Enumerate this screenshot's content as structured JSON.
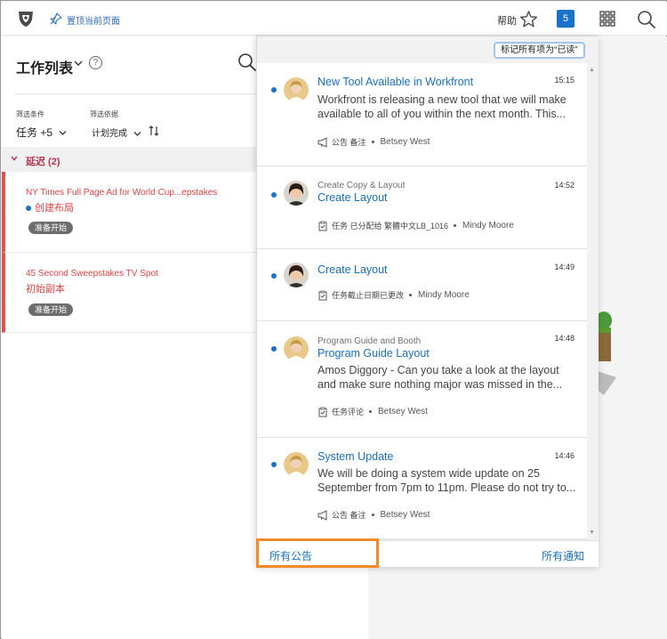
{
  "topbar": {
    "pin_label": "置顶当前页面",
    "help_label": "帮助",
    "notification_count": "5"
  },
  "worklist": {
    "title": "工作列表",
    "help_label": "?",
    "filter_label": "筛选条件",
    "filter_value": "任务 +5",
    "sort_label": "筛选依据",
    "sort_value": "计划完成",
    "group_label": "延迟 (2)",
    "cards": [
      {
        "title": "NY Times Full Page Ad for World Cup...epstakes",
        "status": "创建布局",
        "pill": "准备开始"
      },
      {
        "title": "45 Second Sweepstakes TV Spot",
        "status": "初始副本",
        "pill": "准备开始"
      }
    ]
  },
  "notifications": {
    "mark_all_read": "标记所有项为“已读”",
    "items": [
      {
        "context": "",
        "title": "New Tool Available in Workfront",
        "body": "Workfront is releasing a new tool that we will make available to all of you within the next month. This...",
        "time": "15:15",
        "meta_icon": "megaphone-icon",
        "meta_label": "公告 备注",
        "person": "Betsey West"
      },
      {
        "context": "Create Copy & Layout",
        "title": "Create Layout",
        "body": "",
        "time": "14:52",
        "meta_icon": "task-icon",
        "meta_label": "任务 已分配给 繁體中文LB_1016",
        "person": "Mindy Moore"
      },
      {
        "context": "",
        "title": "Create Layout",
        "body": "",
        "time": "14:49",
        "meta_icon": "task-icon",
        "meta_label": "任务截止日期已更改",
        "person": "Mindy Moore"
      },
      {
        "context": "Program Guide and Booth",
        "title": "Program Guide Layout",
        "body": "Amos Diggory - Can you take a look at the layout and make sure nothing major was missed in the...",
        "time": "14:48",
        "meta_icon": "task-icon",
        "meta_label": "任务评论",
        "person": "Betsey West"
      },
      {
        "context": "",
        "title": "System Update",
        "body": "We will be doing a system wide update on 25 September from 7pm to 11pm. Please do not try to...",
        "time": "14:46",
        "meta_icon": "megaphone-icon",
        "meta_label": "公告 备注",
        "person": "Betsey West"
      }
    ],
    "footer_all_announcements": "所有公告",
    "footer_all_notifications": "所有通知"
  },
  "colors": {
    "accent": "#1a73c9",
    "overdue": "#d94444",
    "highlight": "#f08a2a"
  }
}
